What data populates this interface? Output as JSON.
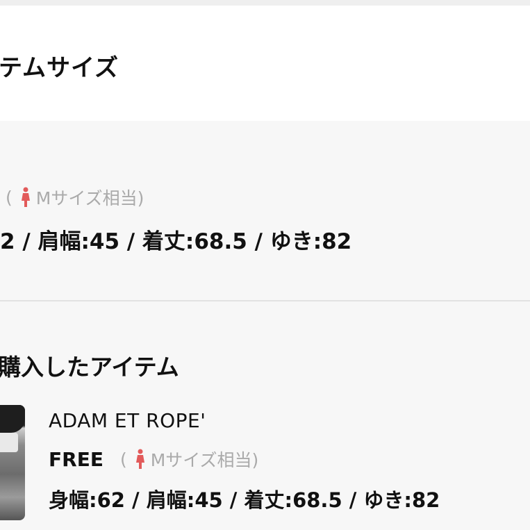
{
  "header": {
    "section_title": "テムサイズ"
  },
  "reference_size": {
    "paren_open": "(",
    "size_label": "Mサイズ相当)",
    "measurements": "2 / 肩幅:45 / 着丈:68.5 / ゆき:82"
  },
  "purchased": {
    "title": "購入したアイテム",
    "item": {
      "brand": "ADAM ET ROPE'",
      "size": "FREE",
      "paren_open": "(",
      "size_label": "Mサイズ相当)",
      "measurements": "身幅:62 / 肩幅:45 / 着丈:68.5 / ゆき:82"
    }
  },
  "colors": {
    "accent_icon": "#e25a5a",
    "muted_text": "#aaaaaa"
  },
  "icons": {
    "body_type": "woman-figure-icon"
  }
}
